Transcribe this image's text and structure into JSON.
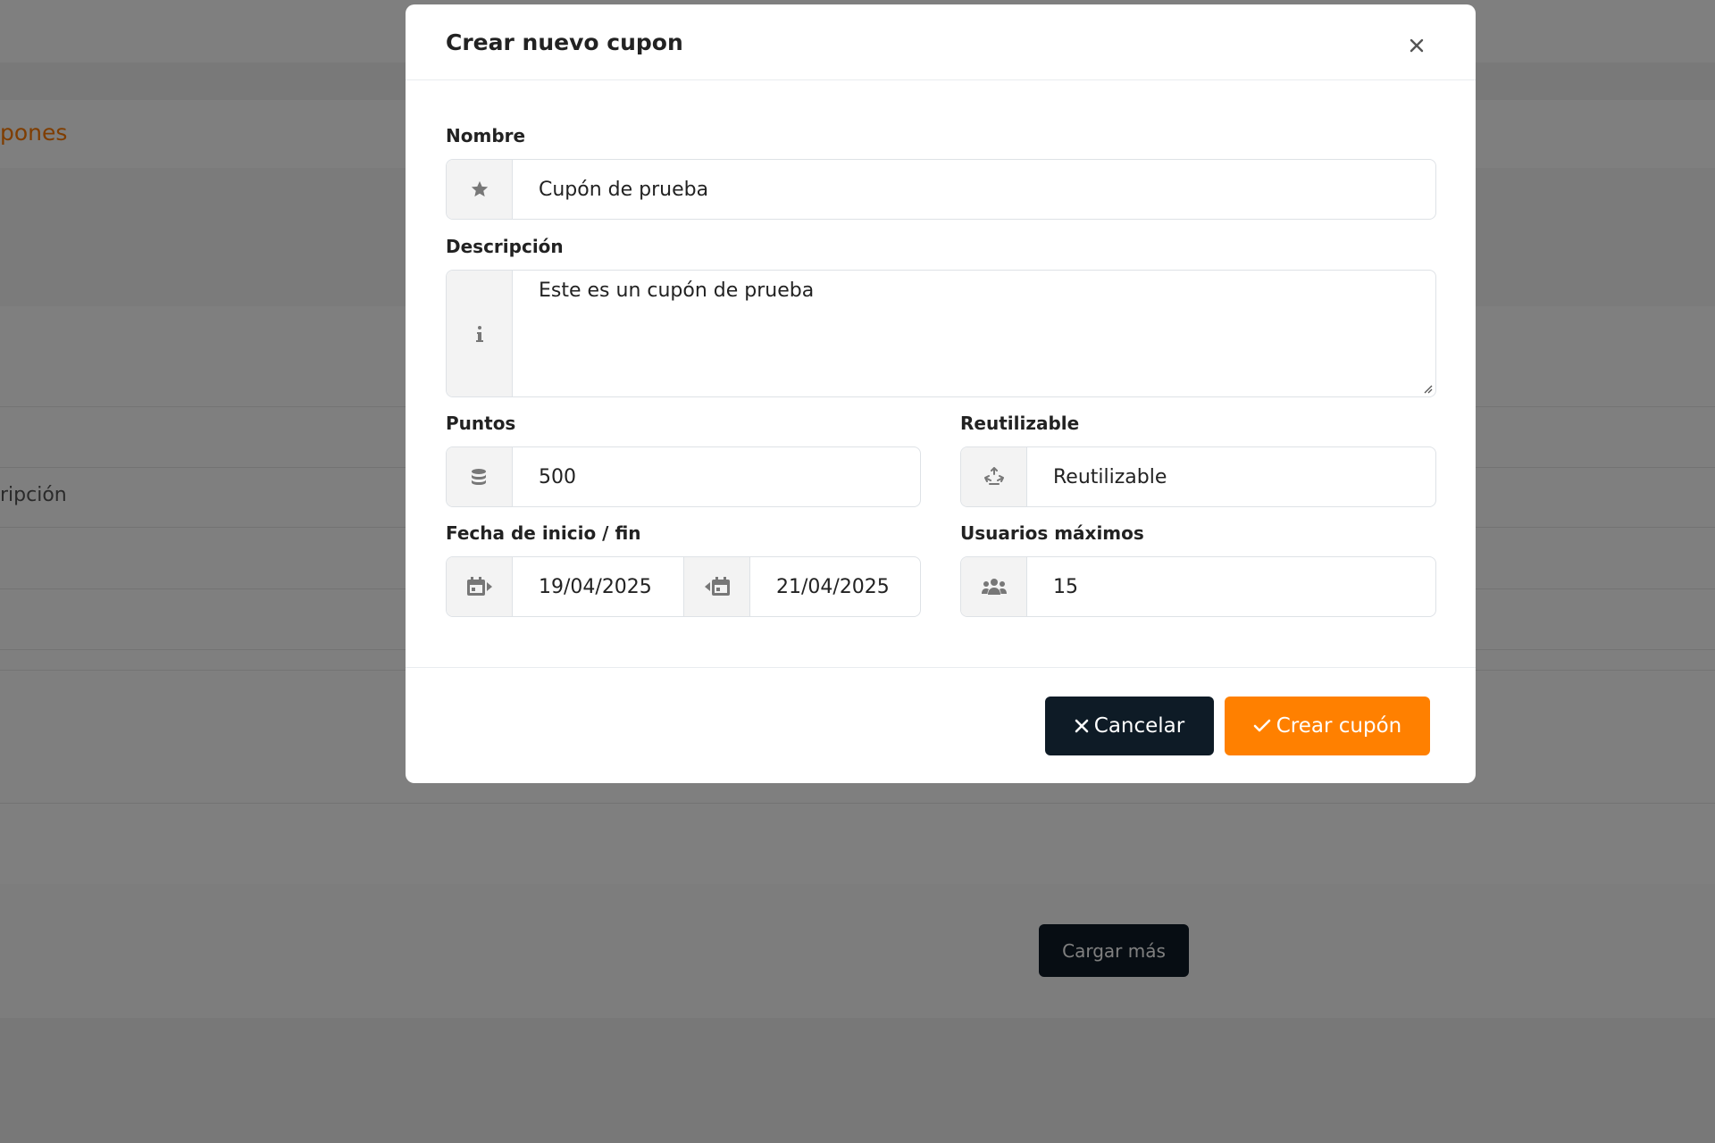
{
  "background": {
    "section_tab": "pones",
    "column_header": "ripción",
    "load_more_label": "Cargar más"
  },
  "modal": {
    "title": "Crear nuevo cupon",
    "fields": {
      "nombre": {
        "label": "Nombre",
        "value": "Cupón de prueba",
        "icon": "star-icon"
      },
      "descripcion": {
        "label": "Descripción",
        "value": "Este es un cupón de prueba",
        "icon": "info-icon"
      },
      "puntos": {
        "label": "Puntos",
        "value": "500",
        "icon": "coins-icon"
      },
      "reutilizable": {
        "label": "Reutilizable",
        "value": "Reutilizable",
        "icon": "recycle-icon"
      },
      "fechas": {
        "label": "Fecha de inicio / fin",
        "start": "19/04/2025",
        "end": "21/04/2025"
      },
      "usuarios": {
        "label": "Usuarios máximos",
        "value": "15",
        "icon": "users-icon"
      }
    },
    "buttons": {
      "cancel_label": "Cancelar",
      "create_label": "Crear cupón"
    }
  },
  "colors": {
    "accent": "#ff8000",
    "dark": "#0e1b26"
  }
}
